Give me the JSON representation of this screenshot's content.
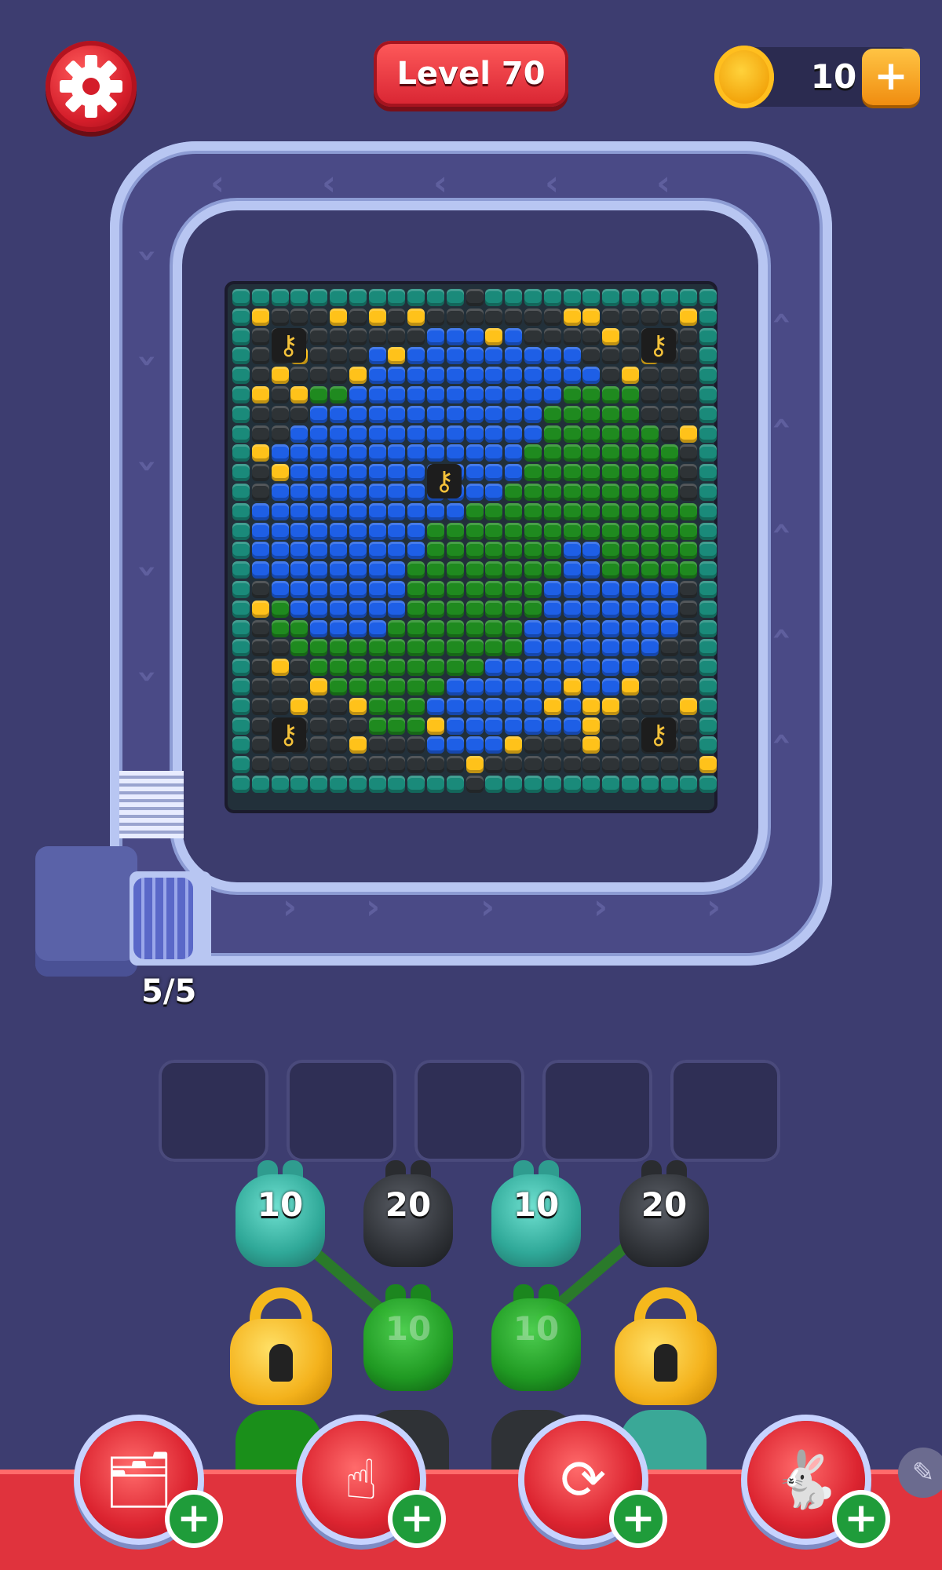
{
  "header": {
    "settings_icon": "gear-icon",
    "level_label": "Level 70",
    "coins": "10",
    "coin_icon": "coin-icon",
    "add_coins_icon": "plus-icon"
  },
  "board": {
    "grid_cols": 25,
    "grid_rows": 26,
    "colors": {
      "green": "#1f8a1f",
      "blue": "#1e5fe6",
      "teal": "#1a8a7a",
      "dark": "#2e3336",
      "gold": "#ffc21a"
    },
    "key_icon": "key-icon"
  },
  "conveyor": {
    "capacity": "5/5"
  },
  "slots": {
    "count": 5
  },
  "shooters": [
    {
      "value": "10",
      "color": "#3fb7a8",
      "label_visible": true
    },
    {
      "value": "20",
      "color": "#3c3f45",
      "label_visible": true
    },
    {
      "value": "10",
      "color": "#3fb7a8",
      "label_visible": true
    },
    {
      "value": "20",
      "color": "#3c3f45",
      "label_visible": true
    }
  ],
  "shooters_row2": [
    {
      "type": "lock"
    },
    {
      "value": "10",
      "color": "#1fa01f"
    },
    {
      "value": "10",
      "color": "#1fa01f"
    },
    {
      "type": "lock"
    }
  ],
  "powerups": [
    {
      "icon": "add-card-icon"
    },
    {
      "icon": "tap-hand-icon"
    },
    {
      "icon": "shuffle-icon"
    },
    {
      "icon": "rabbit-icon"
    }
  ]
}
